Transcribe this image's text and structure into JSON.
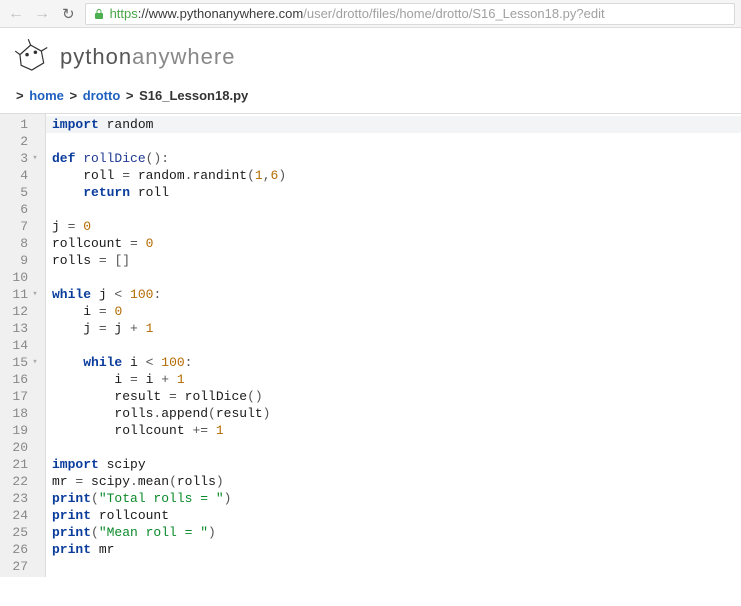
{
  "browser": {
    "url_scheme": "https",
    "url_host": "://www.pythonanywhere.com",
    "url_path": "/user/drotto/files/home/drotto/S16_Lesson18.py?edit"
  },
  "logo": {
    "prefix": "python",
    "suffix": "anywhere"
  },
  "breadcrumb": {
    "sep": ">",
    "items": [
      "home",
      "drotto"
    ],
    "current": "S16_Lesson18.py"
  },
  "editor": {
    "active_line": 1,
    "lines": [
      {
        "n": 1,
        "fold": "",
        "tokens": [
          [
            "kw",
            "import"
          ],
          [
            "id",
            " random"
          ]
        ]
      },
      {
        "n": 2,
        "fold": "",
        "tokens": []
      },
      {
        "n": 3,
        "fold": "▾",
        "tokens": [
          [
            "kw",
            "def"
          ],
          [
            "id",
            " "
          ],
          [
            "fn",
            "rollDice"
          ],
          [
            "op",
            "():"
          ]
        ]
      },
      {
        "n": 4,
        "fold": "",
        "tokens": [
          [
            "id",
            "    roll "
          ],
          [
            "op",
            "="
          ],
          [
            "id",
            " random"
          ],
          [
            "op",
            "."
          ],
          [
            "id",
            "randint"
          ],
          [
            "op",
            "("
          ],
          [
            "num",
            "1"
          ],
          [
            "op",
            ","
          ],
          [
            "num",
            "6"
          ],
          [
            "op",
            ")"
          ]
        ]
      },
      {
        "n": 5,
        "fold": "",
        "tokens": [
          [
            "id",
            "    "
          ],
          [
            "kw",
            "return"
          ],
          [
            "id",
            " roll"
          ]
        ]
      },
      {
        "n": 6,
        "fold": "",
        "tokens": []
      },
      {
        "n": 7,
        "fold": "",
        "tokens": [
          [
            "id",
            "j "
          ],
          [
            "op",
            "="
          ],
          [
            "id",
            " "
          ],
          [
            "num",
            "0"
          ]
        ]
      },
      {
        "n": 8,
        "fold": "",
        "tokens": [
          [
            "id",
            "rollcount "
          ],
          [
            "op",
            "="
          ],
          [
            "id",
            " "
          ],
          [
            "num",
            "0"
          ]
        ]
      },
      {
        "n": 9,
        "fold": "",
        "tokens": [
          [
            "id",
            "rolls "
          ],
          [
            "op",
            "="
          ],
          [
            "id",
            " "
          ],
          [
            "op",
            "[]"
          ]
        ]
      },
      {
        "n": 10,
        "fold": "",
        "tokens": []
      },
      {
        "n": 11,
        "fold": "▾",
        "tokens": [
          [
            "kw",
            "while"
          ],
          [
            "id",
            " j "
          ],
          [
            "op",
            "<"
          ],
          [
            "id",
            " "
          ],
          [
            "num",
            "100"
          ],
          [
            "op",
            ":"
          ]
        ]
      },
      {
        "n": 12,
        "fold": "",
        "tokens": [
          [
            "id",
            "    i "
          ],
          [
            "op",
            "="
          ],
          [
            "id",
            " "
          ],
          [
            "num",
            "0"
          ]
        ]
      },
      {
        "n": 13,
        "fold": "",
        "tokens": [
          [
            "id",
            "    j "
          ],
          [
            "op",
            "="
          ],
          [
            "id",
            " j "
          ],
          [
            "op",
            "+"
          ],
          [
            "id",
            " "
          ],
          [
            "num",
            "1"
          ]
        ]
      },
      {
        "n": 14,
        "fold": "",
        "tokens": []
      },
      {
        "n": 15,
        "fold": "▾",
        "tokens": [
          [
            "id",
            "    "
          ],
          [
            "kw",
            "while"
          ],
          [
            "id",
            " i "
          ],
          [
            "op",
            "<"
          ],
          [
            "id",
            " "
          ],
          [
            "num",
            "100"
          ],
          [
            "op",
            ":"
          ]
        ]
      },
      {
        "n": 16,
        "fold": "",
        "tokens": [
          [
            "id",
            "        i "
          ],
          [
            "op",
            "="
          ],
          [
            "id",
            " i "
          ],
          [
            "op",
            "+"
          ],
          [
            "id",
            " "
          ],
          [
            "num",
            "1"
          ]
        ]
      },
      {
        "n": 17,
        "fold": "",
        "tokens": [
          [
            "id",
            "        result "
          ],
          [
            "op",
            "="
          ],
          [
            "id",
            " rollDice"
          ],
          [
            "op",
            "()"
          ]
        ]
      },
      {
        "n": 18,
        "fold": "",
        "tokens": [
          [
            "id",
            "        rolls"
          ],
          [
            "op",
            "."
          ],
          [
            "id",
            "append"
          ],
          [
            "op",
            "("
          ],
          [
            "id",
            "result"
          ],
          [
            "op",
            ")"
          ]
        ]
      },
      {
        "n": 19,
        "fold": "",
        "tokens": [
          [
            "id",
            "        rollcount "
          ],
          [
            "op",
            "+="
          ],
          [
            "id",
            " "
          ],
          [
            "num",
            "1"
          ]
        ]
      },
      {
        "n": 20,
        "fold": "",
        "tokens": []
      },
      {
        "n": 21,
        "fold": "",
        "tokens": [
          [
            "kw",
            "import"
          ],
          [
            "id",
            " scipy"
          ]
        ]
      },
      {
        "n": 22,
        "fold": "",
        "tokens": [
          [
            "id",
            "mr "
          ],
          [
            "op",
            "="
          ],
          [
            "id",
            " scipy"
          ],
          [
            "op",
            "."
          ],
          [
            "id",
            "mean"
          ],
          [
            "op",
            "("
          ],
          [
            "id",
            "rolls"
          ],
          [
            "op",
            ")"
          ]
        ]
      },
      {
        "n": 23,
        "fold": "",
        "tokens": [
          [
            "kw",
            "print"
          ],
          [
            "op",
            "("
          ],
          [
            "str",
            "\"Total rolls = \""
          ],
          [
            "op",
            ")"
          ]
        ]
      },
      {
        "n": 24,
        "fold": "",
        "tokens": [
          [
            "kw",
            "print"
          ],
          [
            "id",
            " rollcount"
          ]
        ]
      },
      {
        "n": 25,
        "fold": "",
        "tokens": [
          [
            "kw",
            "print"
          ],
          [
            "op",
            "("
          ],
          [
            "str",
            "\"Mean roll = \""
          ],
          [
            "op",
            ")"
          ]
        ]
      },
      {
        "n": 26,
        "fold": "",
        "tokens": [
          [
            "kw",
            "print"
          ],
          [
            "id",
            " mr"
          ]
        ]
      },
      {
        "n": 27,
        "fold": "",
        "tokens": []
      }
    ]
  }
}
